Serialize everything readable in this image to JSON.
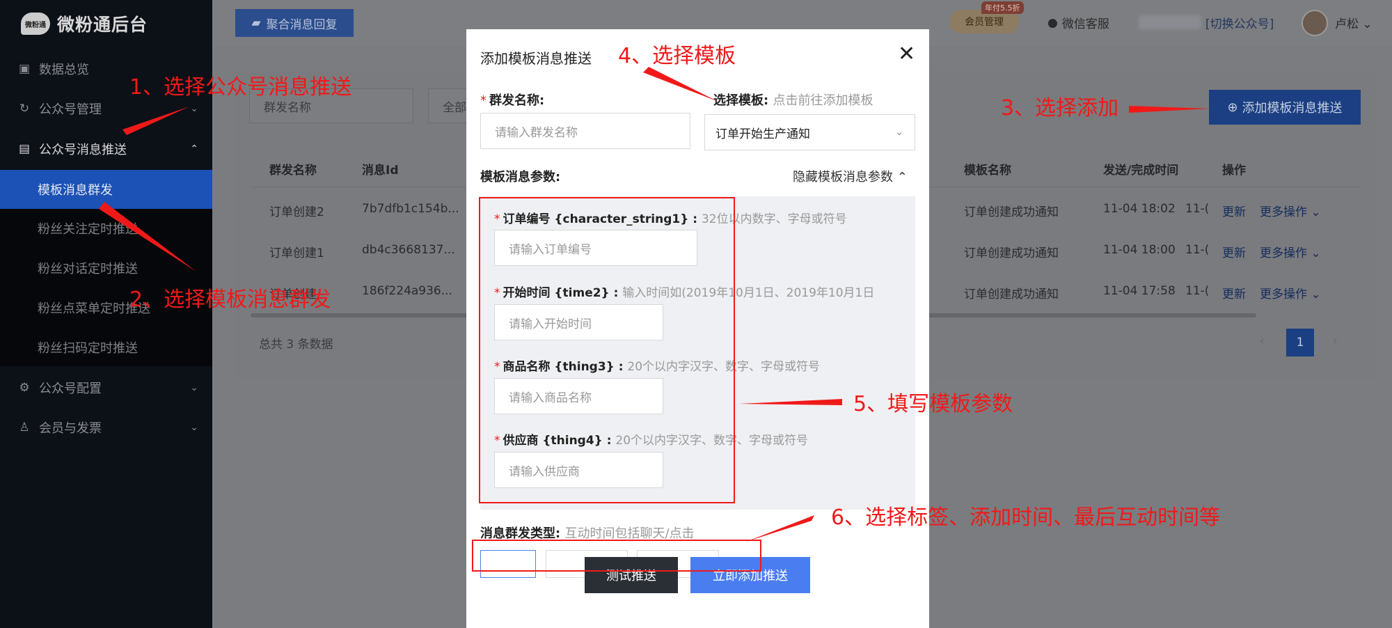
{
  "app": {
    "logo_badge": "微粉通",
    "name": "微粉通后台"
  },
  "sidebar": {
    "items": [
      {
        "label": "数据总览",
        "icon": "chart-icon"
      },
      {
        "label": "公众号管理",
        "icon": "refresh-icon"
      },
      {
        "label": "公众号消息推送",
        "icon": "message-icon",
        "expanded": true
      },
      {
        "label": "公众号配置",
        "icon": "gear-icon"
      },
      {
        "label": "会员与发票",
        "icon": "user-icon"
      }
    ],
    "sub_items": [
      {
        "label": "模板消息群发",
        "active": true
      },
      {
        "label": "粉丝关注定时推送"
      },
      {
        "label": "粉丝对话定时推送"
      },
      {
        "label": "粉丝点菜单定时推送"
      },
      {
        "label": "粉丝扫码定时推送"
      }
    ]
  },
  "topbar": {
    "aggregate_reply": "聚合消息回复",
    "vip_tag": "年付5.5折",
    "vip_label": "会员管理",
    "wechat_service": "微信客服",
    "switch_account": "[切换公众号]",
    "user_name": "卢松"
  },
  "main": {
    "filter_name_placeholder": "群发名称",
    "filter_status": "全部",
    "add_template_button": "添加模板消息推送",
    "table": {
      "headers": [
        "群发名称",
        "消息Id",
        "模板名称",
        "发送/完成时间",
        "操作"
      ],
      "rows": [
        {
          "name": "订单创建2",
          "msg_id": "7b7dfb1c154b...",
          "template": "订单创建成功通知",
          "time": "11-04 18:02",
          "time_tail": "11-(",
          "update": "更新",
          "more": "更多操作"
        },
        {
          "name": "订单创建1",
          "msg_id": "db4c3668137...",
          "template": "订单创建成功通知",
          "time": "11-04 18:00",
          "time_tail": "11-(",
          "update": "更新",
          "more": "更多操作"
        },
        {
          "name": "订单创建",
          "msg_id": "186f224a936...",
          "template": "订单创建成功通知",
          "time": "11-04 17:58",
          "time_tail": "11-(",
          "update": "更新",
          "more": "更多操作"
        }
      ]
    },
    "total": "总共 3 条数据",
    "current_page": "1"
  },
  "modal": {
    "title": "添加模板消息推送",
    "group_name_label": "群发名称:",
    "group_name_placeholder": "请输入群发名称",
    "template_label": "选择模板:",
    "template_hint": "点击前往添加模板",
    "template_selected": "订单开始生产通知",
    "params_label": "模板消息参数:",
    "hide_params": "隐藏模板消息参数",
    "params": [
      {
        "label": "订单编号 {character_string1} :",
        "hint": "32位以内数字、字母或符号",
        "placeholder": "请输入订单编号"
      },
      {
        "label": "开始时间 {time2} :",
        "hint": "输入时间如(2019年10月1日、2019年10月1日",
        "placeholder": "请输入开始时间"
      },
      {
        "label": "商品名称 {thing3} :",
        "hint": "20个以内字汉字、数字、字母或符号",
        "placeholder": "请输入商品名称"
      },
      {
        "label": "供应商 {thing4} :",
        "hint": "20个以内字汉字、数字、字母或符号",
        "placeholder": "请输入供应商"
      }
    ],
    "send_type_label": "消息群发类型:",
    "send_type_hint": "互动时间包括聊天/点击",
    "test_button": "测试推送",
    "submit_button": "立即添加推送"
  },
  "annotations": [
    "1、选择公众号消息推送",
    "2、选择模板消息群发",
    "3、选择添加",
    "4、选择模板",
    "5、填写模板参数",
    "6、选择标签、添加时间、最后互动时间等"
  ],
  "colors": {
    "annotation": "#f01919",
    "primary": "#4a7ef0",
    "active_menu": "#1c52b6"
  }
}
